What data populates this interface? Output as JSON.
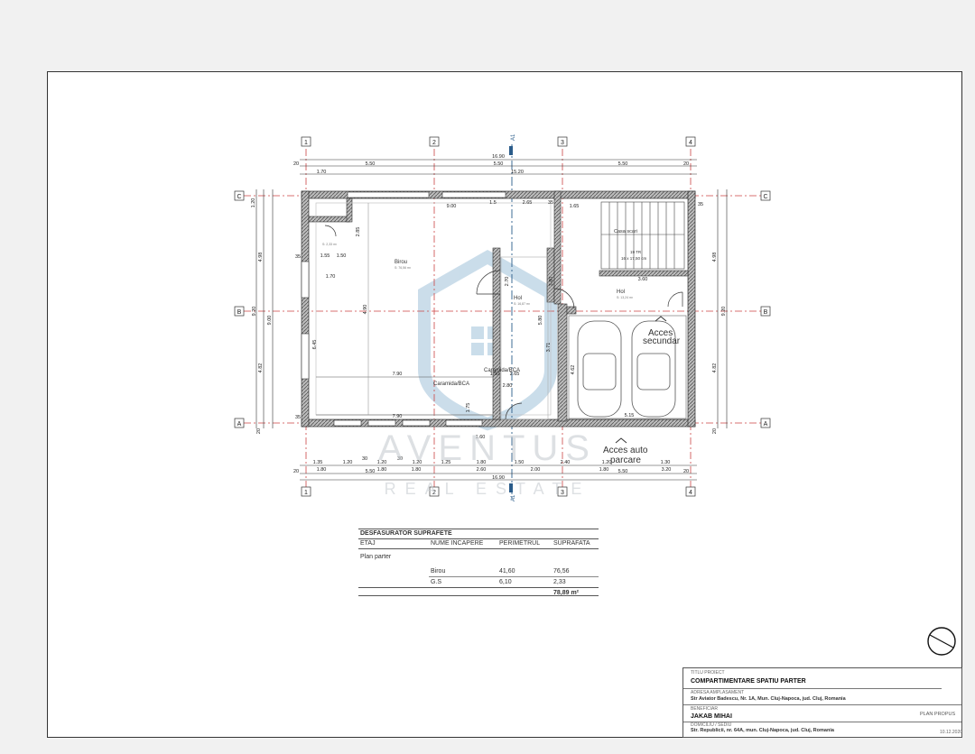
{
  "plan": {
    "axis_labels": {
      "cols": [
        "1",
        "2",
        "3",
        "4"
      ],
      "rows": [
        "C",
        "B",
        "A"
      ]
    },
    "section_marks": [
      "A1",
      "A1"
    ],
    "dims_top": {
      "overall": "16.90",
      "spans": [
        "5.50",
        "5.50",
        "5.50"
      ],
      "edges": [
        "20",
        "20"
      ],
      "inner": [
        "1.70",
        "15.20"
      ]
    },
    "dims_bottom": {
      "row1": [
        "1.35",
        "1.20",
        "30",
        "1.20",
        "30",
        "1.20",
        "1.25",
        "1.80",
        "1.50",
        "2.40",
        "1.20",
        "1.30"
      ],
      "row2": [
        "1.80",
        "1.80",
        "1.80",
        "2.60",
        "2.00",
        "1.80",
        "3.20"
      ],
      "spans": [
        "5.50",
        "5.50",
        "5.50"
      ],
      "overall": "16.90",
      "edges": [
        "20",
        "20"
      ]
    },
    "dims_left": [
      "1.20",
      "4.98",
      "4.82",
      "9.00",
      "9.20",
      "35",
      "35",
      "20"
    ],
    "dims_right": [
      "35",
      "4.98",
      "4.82",
      "9.20",
      "20"
    ],
    "interior_dims": [
      "9.00",
      "1.5",
      "2.65",
      "1.65",
      "35",
      "1.70",
      "1.55",
      "1.50",
      "7.90",
      "7.90",
      "6.45",
      "4.90",
      "2.70",
      "3.80",
      "5.80",
      "3.71",
      "2.65",
      "4.62",
      "3.60",
      "5.15",
      "2.80",
      "1.50",
      "1.60",
      "1.75",
      "2.85"
    ],
    "rooms": {
      "birou": {
        "name": "Birou",
        "area": "S: 76,56 m²"
      },
      "hol_center": {
        "name": "Hol",
        "area": "S: 16,87 m²"
      },
      "hol_right": {
        "name": "Hol",
        "area": "S: 13,24 m²"
      },
      "casa_scari": {
        "name": "Casa scari"
      },
      "gs": {
        "area": "S: 2,33 m²"
      }
    },
    "materials": [
      "Caramida/BCA",
      "Caramida/BCA"
    ],
    "labels": {
      "acces_secundar": [
        "Acces",
        "secundar"
      ],
      "acces_auto": [
        "Acces auto",
        "parcare"
      ]
    },
    "stair_labels": [
      "19 TR",
      "16 x 17,50 cm"
    ]
  },
  "watermark": {
    "brand": "AVENTUS",
    "sub": "REAL ESTATE"
  },
  "table": {
    "title": "DESFASURATOR SUPRAFETE",
    "headers": [
      "ETAJ",
      "NUME INCAPERE",
      "PERIMETRUL",
      "SUPRAFATA"
    ],
    "floor": "Plan parter",
    "rows": [
      {
        "name": "Birou",
        "perimeter": "41,60",
        "area": "76,56"
      },
      {
        "name": "G.S",
        "perimeter": "6,10",
        "area": "2,33"
      }
    ],
    "total": "78,89 m²"
  },
  "title_block": {
    "titlu_label": "TITLU PROIECT",
    "titlu": "COMPARTIMENTARE SPATIU PARTER",
    "adresa_label": "ADRESA AMPLASAMENT",
    "adresa": "Str Aviator Badescu, Nr. 1A, Mun. Cluj-Napoca, jud. Cluj, Romania",
    "beneficiar_label": "BENEFICIAR",
    "beneficiar": "JAKAB MIHAI",
    "sheet_name": "PLAN PROPUS",
    "domiciliu_label": "DOMICILIU / SEDIU",
    "domiciliu": "Str. Republicii, nr. 64A, mun. Cluj-Napoca, jud. Cluj, Romania",
    "date": "10.12.2020"
  }
}
